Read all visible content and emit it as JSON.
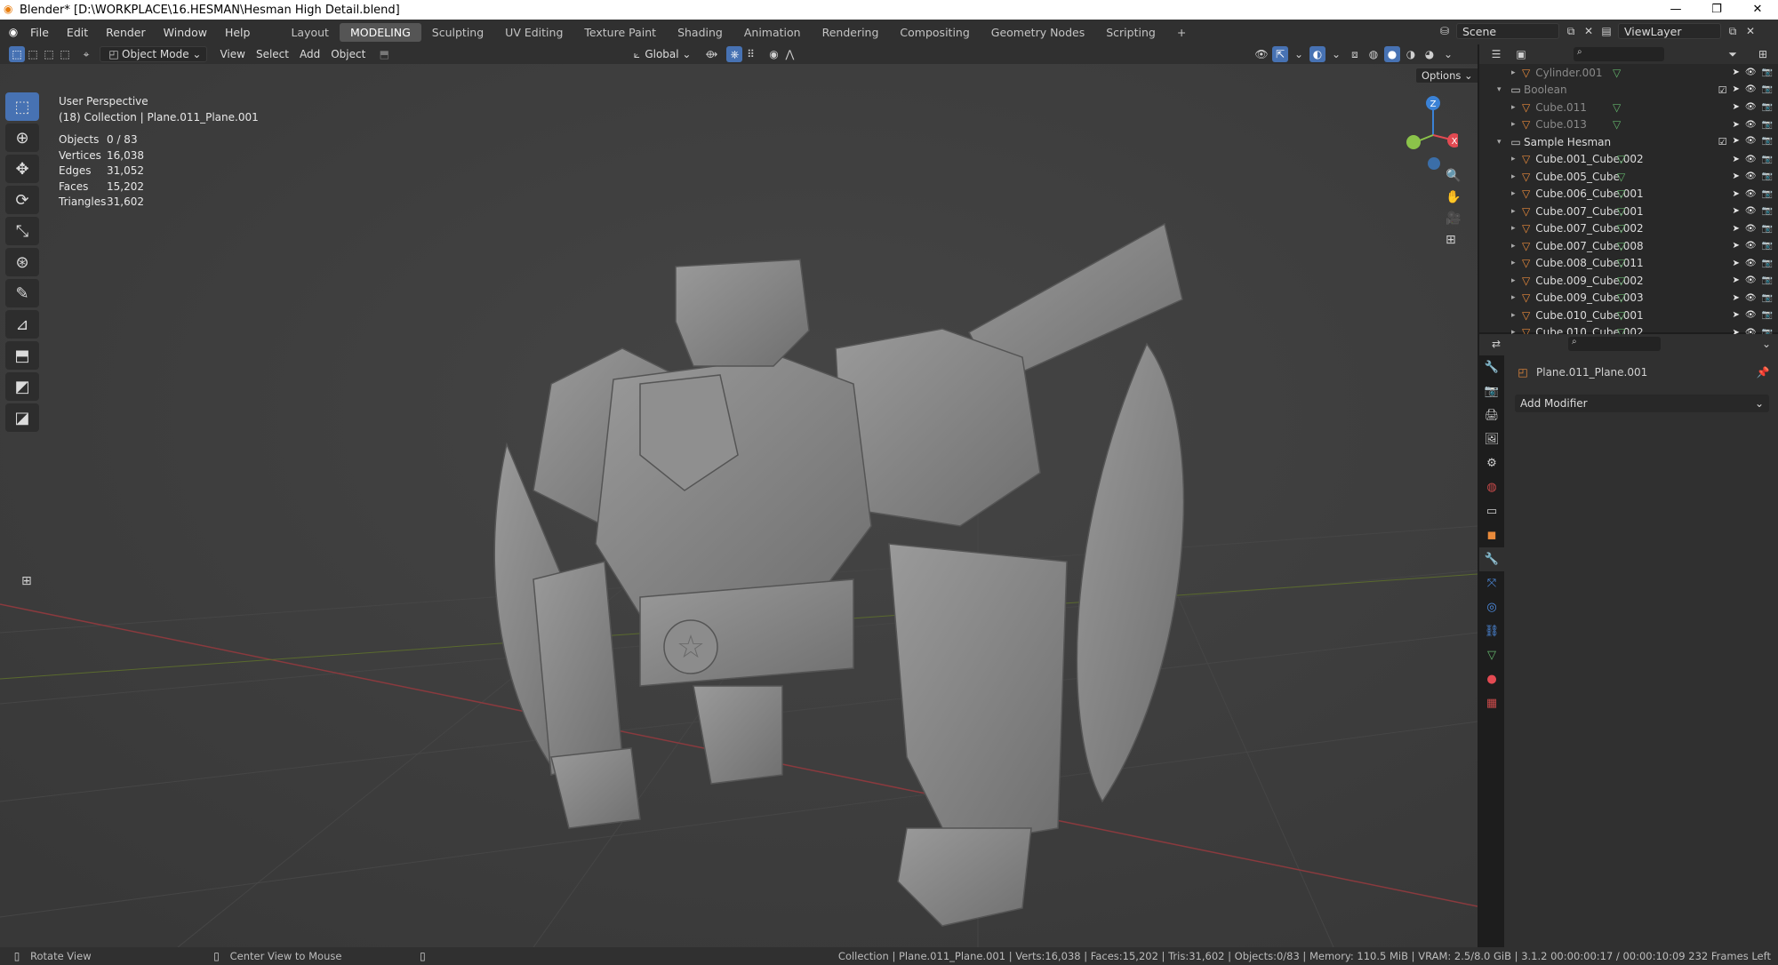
{
  "window": {
    "title": "Blender* [D:\\WORKPLACE\\16.HESMAN\\Hesman High Detail.blend]"
  },
  "menu": [
    "File",
    "Edit",
    "Render",
    "Window",
    "Help"
  ],
  "workspaces": [
    "Layout",
    "MODELING",
    "Sculpting",
    "UV Editing",
    "Texture Paint",
    "Shading",
    "Animation",
    "Rendering",
    "Compositing",
    "Geometry Nodes",
    "Scripting"
  ],
  "active_workspace": "MODELING",
  "scene": {
    "name": "Scene",
    "view_layer": "ViewLayer"
  },
  "header": {
    "mode": "Object Mode",
    "menus": [
      "View",
      "Select",
      "Add",
      "Object"
    ],
    "orientation": "Global",
    "options": "Options"
  },
  "overlay": {
    "perspective": "User Perspective",
    "collection": "(18) Collection | Plane.011_Plane.001",
    "stats": [
      {
        "k": "Objects",
        "v": "0 / 83"
      },
      {
        "k": "Vertices",
        "v": "16,038"
      },
      {
        "k": "Edges",
        "v": "31,052"
      },
      {
        "k": "Faces",
        "v": "15,202"
      },
      {
        "k": "Triangles",
        "v": "31,602"
      }
    ]
  },
  "gizmo": {
    "x": "X",
    "z": "Z"
  },
  "outliner": {
    "rows": [
      {
        "label": "Cylinder.001",
        "dim": true,
        "type": "mesh",
        "indent": 2
      },
      {
        "label": "Boolean",
        "dim": true,
        "type": "collection",
        "indent": 1
      },
      {
        "label": "Cube.011",
        "dim": true,
        "type": "mesh",
        "indent": 2
      },
      {
        "label": "Cube.013",
        "dim": true,
        "type": "mesh",
        "indent": 2
      },
      {
        "label": "Sample Hesman",
        "dim": false,
        "type": "collection",
        "indent": 1
      },
      {
        "label": "Cube.001_Cube.002",
        "dim": false,
        "type": "mesh",
        "indent": 2
      },
      {
        "label": "Cube.005_Cube",
        "dim": false,
        "type": "mesh",
        "indent": 2
      },
      {
        "label": "Cube.006_Cube.001",
        "dim": false,
        "type": "mesh",
        "indent": 2
      },
      {
        "label": "Cube.007_Cube.001",
        "dim": false,
        "type": "mesh",
        "indent": 2
      },
      {
        "label": "Cube.007_Cube.002",
        "dim": false,
        "type": "mesh",
        "indent": 2
      },
      {
        "label": "Cube.007_Cube.008",
        "dim": false,
        "type": "mesh",
        "indent": 2
      },
      {
        "label": "Cube.008_Cube.011",
        "dim": false,
        "type": "mesh",
        "indent": 2
      },
      {
        "label": "Cube.009_Cube.002",
        "dim": false,
        "type": "mesh",
        "indent": 2
      },
      {
        "label": "Cube.009_Cube.003",
        "dim": false,
        "type": "mesh",
        "indent": 2
      },
      {
        "label": "Cube.010_Cube.001",
        "dim": false,
        "type": "mesh",
        "indent": 2
      },
      {
        "label": "Cube.010_Cube.002",
        "dim": false,
        "type": "mesh",
        "indent": 2
      }
    ]
  },
  "properties": {
    "object": "Plane.011_Plane.001",
    "add_modifier": "Add Modifier"
  },
  "status": {
    "left1": "Rotate View",
    "left2": "Center View to Mouse",
    "right": "Collection | Plane.011_Plane.001 | Verts:16,038 | Faces:15,202 | Tris:31,602 | Objects:0/83 | Memory: 110.5 MiB | VRAM: 2.5/8.0 GiB | 3.1.2  00:00:00:17 / 00:00:10:09  232 Frames Left"
  },
  "colors": {
    "accent": "#4772b3",
    "mesh": "#e98a3b",
    "geometry": "#63b36b",
    "axis_x": "#e34a52",
    "axis_y": "#8bc34a",
    "axis_z": "#3b82d6"
  }
}
